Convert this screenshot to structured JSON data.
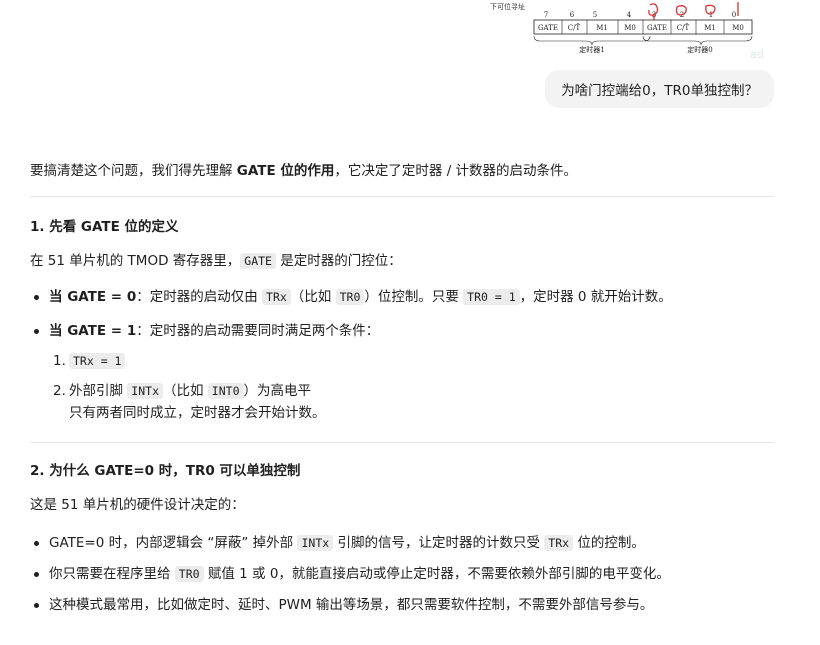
{
  "attachment": {
    "caption": "下可位寻址",
    "bit_numbers": [
      "7",
      "6",
      "5",
      "4",
      "3",
      "2",
      "1",
      "0"
    ],
    "fields": [
      "GATE",
      "C/T̄",
      "M1",
      "M0",
      "GATE",
      "C/T̄",
      "M1",
      "M0"
    ],
    "group_labels": [
      "定时器1",
      "定时器0"
    ]
  },
  "user_message": "为啥门控端给0，TR0单独控制？",
  "answer": {
    "intro": {
      "pre": "要搞清楚这个问题，我们得先理解 ",
      "bold": "GATE 位的作用",
      "post": "，它决定了定时器 / 计数器的启动条件。"
    },
    "section1": {
      "heading": "1. 先看 GATE 位的定义",
      "desc_pre": "在 51 单片机的 TMOD 寄存器里，",
      "desc_code": "GATE",
      "desc_post": " 是定时器的门控位：",
      "item1": {
        "bold": "当 GATE = 0",
        "t1": "：定时器的启动仅由 ",
        "c1": "TRx",
        "t2": "（比如 ",
        "c2": "TR0",
        "t3": "）位控制。只要 ",
        "c3": "TR0 = 1",
        "t4": "，定时器 0 就开始计数。"
      },
      "item2": {
        "bold": "当 GATE = 1",
        "t1": "：定时器的启动需要同时满足两个条件：",
        "sub1_num": "1.",
        "sub1_code": "TRx = 1",
        "sub2_num": "2.",
        "sub2_t1": "外部引脚 ",
        "sub2_c1": "INTx",
        "sub2_t2": "（比如 ",
        "sub2_c2": "INT0",
        "sub2_t3": "）为高电平",
        "sub2_cont": "只有两者同时成立，定时器才会开始计数。"
      }
    },
    "section2": {
      "heading": "2. 为什么 GATE=0 时，TR0 可以单独控制",
      "desc": "这是 51 单片机的硬件设计决定的：",
      "b1_t1": "GATE=0 时，内部逻辑会 “屏蔽” 掉外部 ",
      "b1_c1": "INTx",
      "b1_t2": " 引脚的信号，让定时器的计数只受 ",
      "b1_c2": "TRx",
      "b1_t3": " 位的控制。",
      "b2_t1": "你只需要在程序里给 ",
      "b2_c1": "TR0",
      "b2_t2": " 赋值 1 或 0，就能直接启动或停止定时器，不需要依赖外部引脚的电平变化。",
      "b3": "这种模式最常用，比如做定时、延时、PWM 输出等场景，都只需要软件控制，不需要外部信号参与。"
    }
  },
  "colors": {
    "annotation_red": "#e03030",
    "bubble_bg": "#f3f3f3"
  }
}
